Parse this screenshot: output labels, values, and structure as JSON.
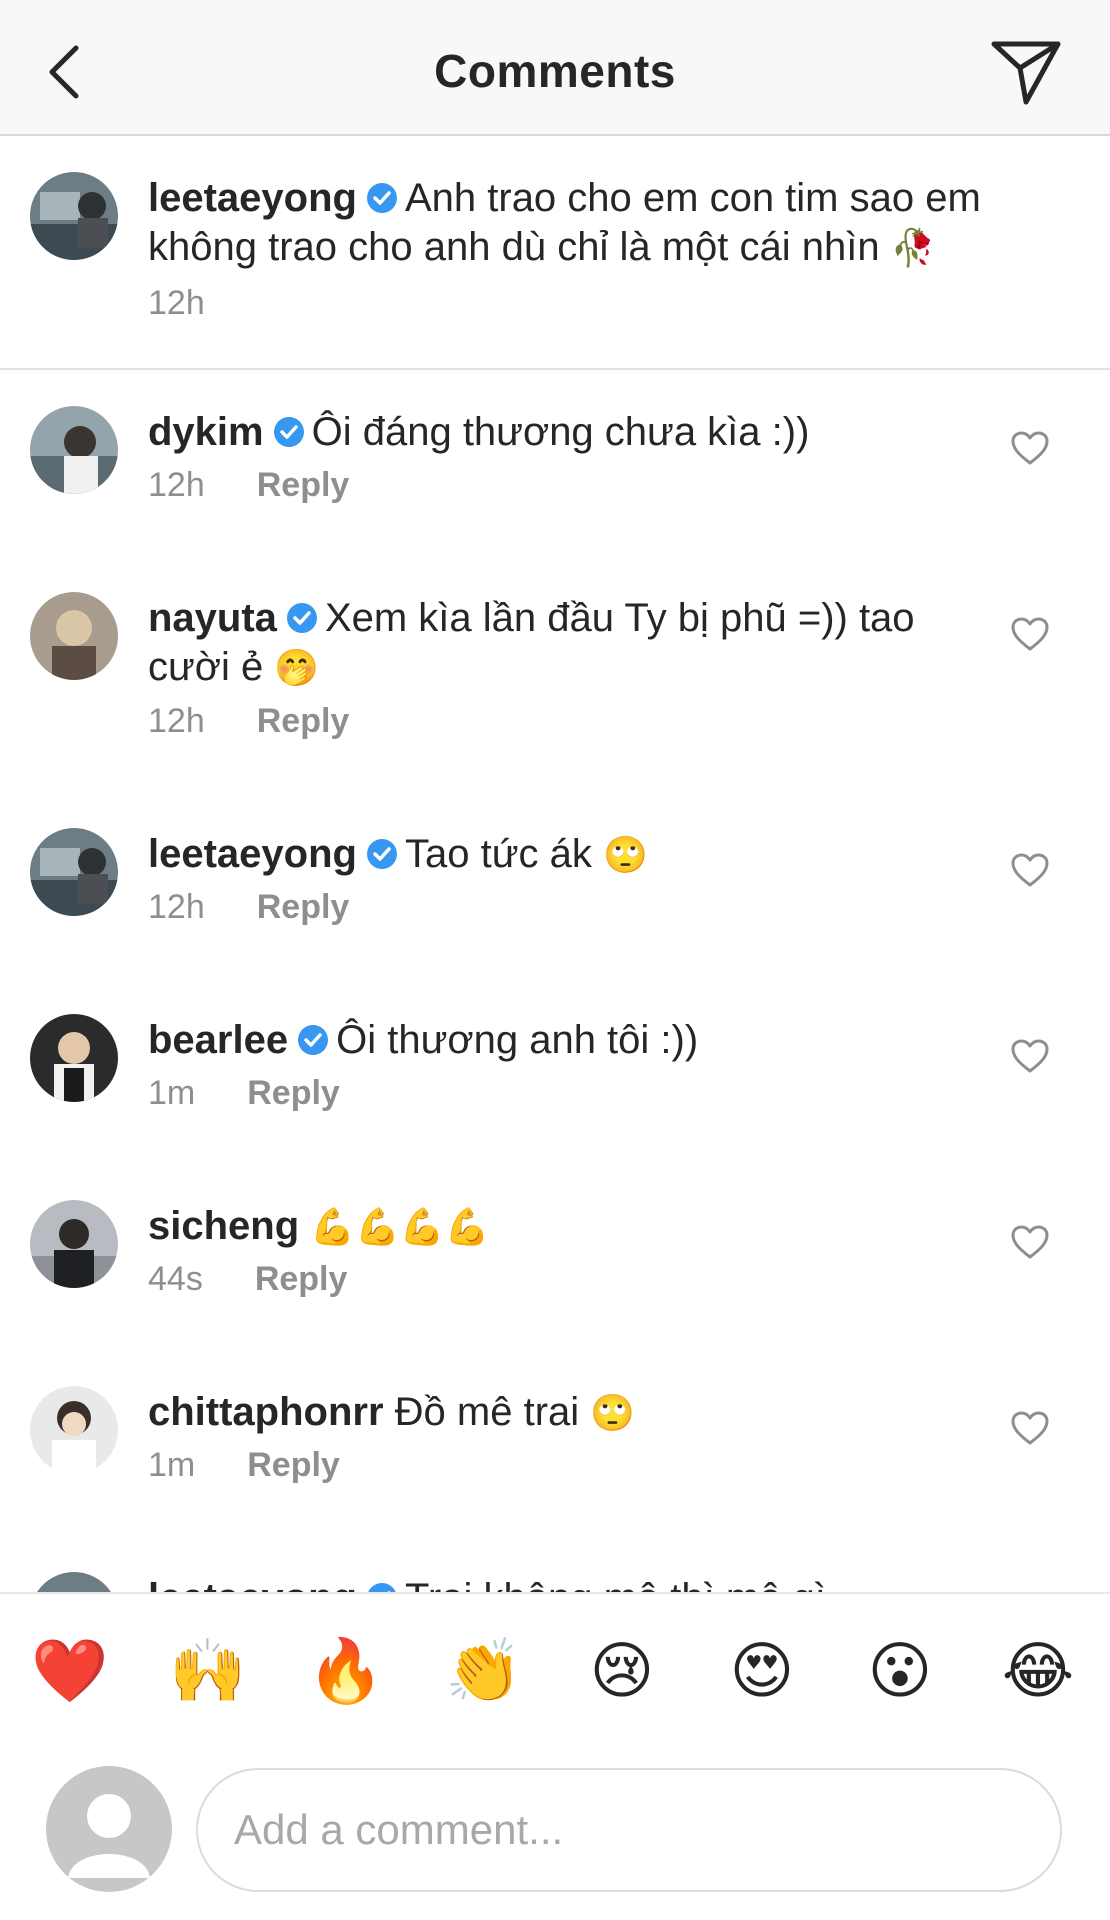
{
  "header": {
    "title": "Comments"
  },
  "caption": {
    "username": "leetaeyong",
    "verified": true,
    "text": "Anh trao cho em con tim sao em không trao cho anh dù chỉ là một cái nhìn",
    "emoji": "🥀",
    "time": "12h"
  },
  "comments": [
    {
      "username": "dykim",
      "verified": true,
      "text": "Ôi đáng thương chưa kìa :))",
      "emoji": "",
      "time": "12h",
      "reply": "Reply"
    },
    {
      "username": "nayuta",
      "verified": true,
      "text": "Xem kìa lần đầu Ty bị phũ =)) tao cười ẻ",
      "emoji": "🤭",
      "time": "12h",
      "reply": "Reply"
    },
    {
      "username": "leetaeyong",
      "verified": true,
      "text": "Tao tức ák",
      "emoji": "🙄",
      "time": "12h",
      "reply": "Reply"
    },
    {
      "username": "bearlee",
      "verified": true,
      "text": "Ôi thương anh tôi :))",
      "emoji": "",
      "time": "1m",
      "reply": "Reply"
    },
    {
      "username": "sicheng",
      "verified": false,
      "text": "",
      "emoji": "💪💪💪💪",
      "time": "44s",
      "reply": "Reply"
    },
    {
      "username": "chittaphonrr",
      "verified": false,
      "text": "Đồ mê trai",
      "emoji": "🙄",
      "time": "1m",
      "reply": "Reply"
    },
    {
      "username": "leetaeyong",
      "verified": true,
      "text": "Trai không mê thì mê gì",
      "emoji": "",
      "time": "",
      "reply": ""
    }
  ],
  "reactions": [
    "❤️",
    "🙌",
    "🔥",
    "👏",
    "😢",
    "😍",
    "😮",
    "😂"
  ],
  "composer": {
    "placeholder": "Add a comment..."
  },
  "colors": {
    "verified": "#3897f0",
    "meta": "#8e8e8e",
    "text": "#262626"
  }
}
